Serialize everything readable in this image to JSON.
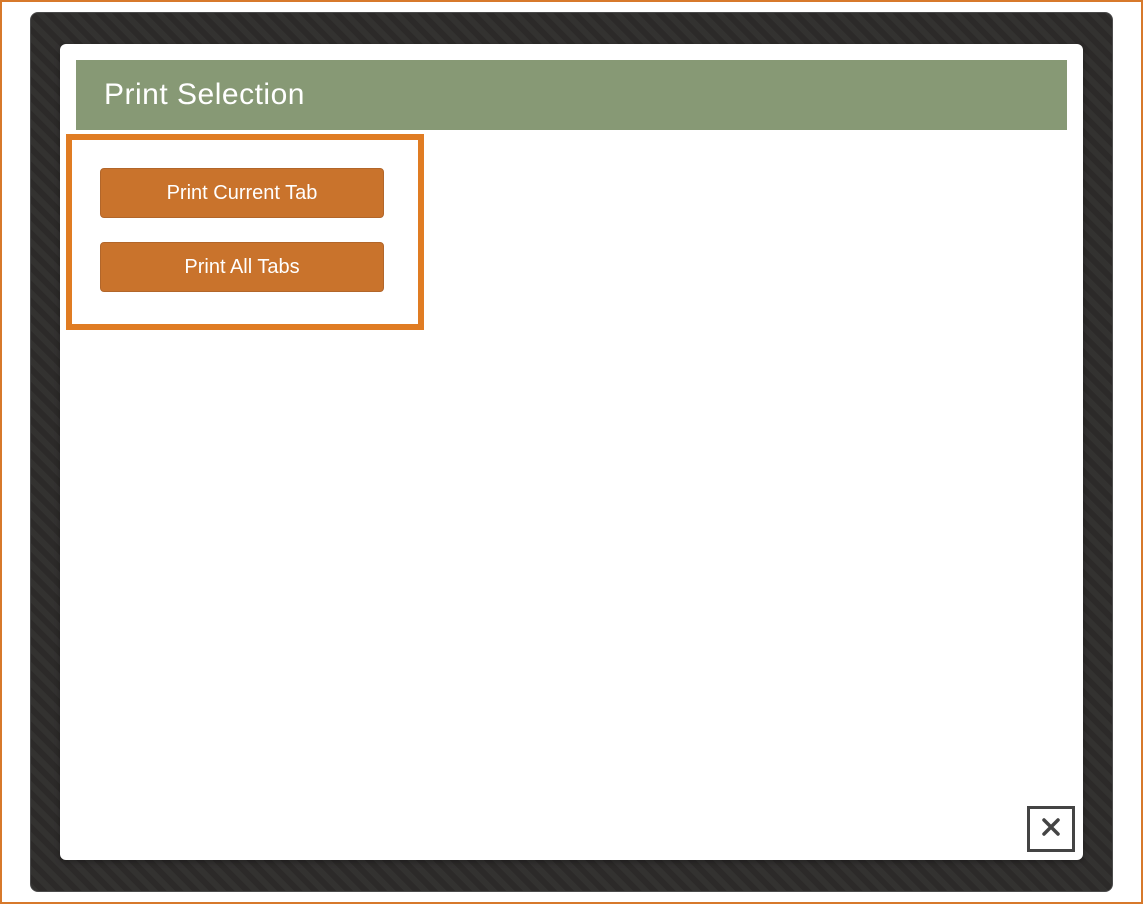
{
  "modal": {
    "title": "Print Selection",
    "buttons": {
      "print_current": "Print Current Tab",
      "print_all": "Print All Tabs"
    }
  },
  "colors": {
    "accent_orange": "#e07c23",
    "button_orange": "#c9732c",
    "header_green": "#879975",
    "backdrop_dark": "#2c2a29"
  }
}
